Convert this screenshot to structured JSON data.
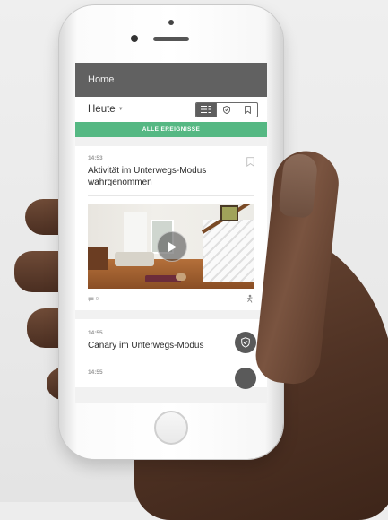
{
  "app": {
    "header_title": "Home"
  },
  "filter": {
    "period_label": "Heute",
    "view_toggle": {
      "options": [
        "list-icon",
        "shield-icon",
        "bookmark-icon"
      ],
      "selected": "list-icon"
    }
  },
  "all_events_label": "ALLE EREIGNISSE",
  "events": [
    {
      "time": "14:53",
      "title": "Aktivität im Unterwegs-Modus wahrgenommen",
      "comment_count": "0"
    },
    {
      "time": "14:55",
      "title": "Canary im Unterwegs-Modus"
    },
    {
      "time": "14:55"
    }
  ],
  "colors": {
    "header_bg": "#616161",
    "accent_green": "#55b883",
    "badge_bg": "#5a5a5a"
  }
}
